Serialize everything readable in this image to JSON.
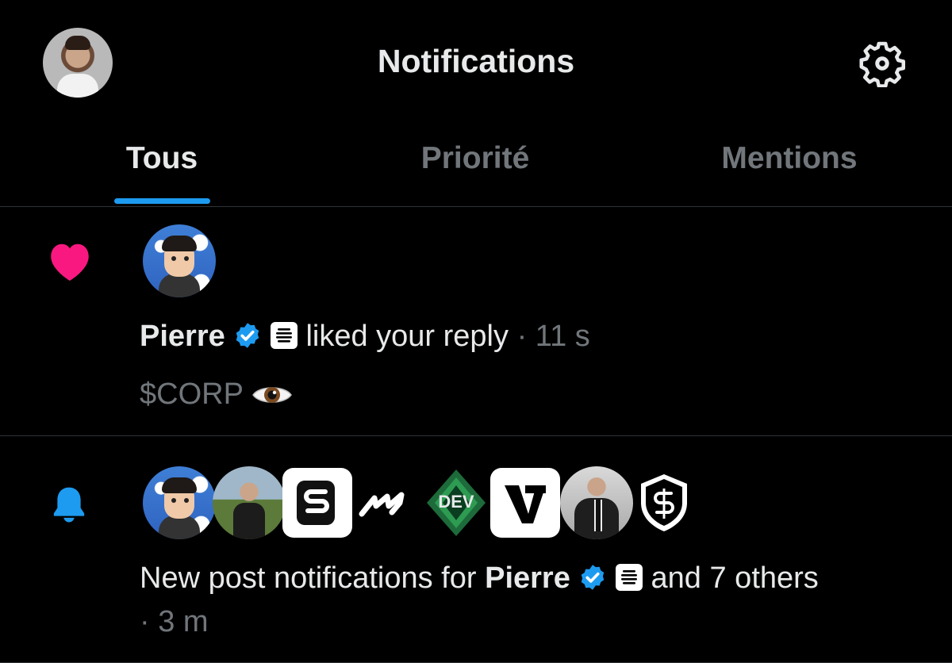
{
  "header": {
    "title": "Notifications"
  },
  "tabs": [
    {
      "label": "Tous",
      "active": true
    },
    {
      "label": "Priorité",
      "active": false
    },
    {
      "label": "Mentions",
      "active": false
    }
  ],
  "notifications": [
    {
      "type": "like",
      "user": "Pierre",
      "action": "liked your reply",
      "time": "· 11 s",
      "snippet": "$CORP"
    },
    {
      "type": "new-post",
      "prefix": "New post notifications for",
      "user": "Pierre",
      "suffix": "and 7 others",
      "time": "· 3 m",
      "avatar_text_dev": "DEV"
    }
  ],
  "colors": {
    "accent": "#1d9bf0",
    "like": "#f91880",
    "background": "#000000"
  }
}
